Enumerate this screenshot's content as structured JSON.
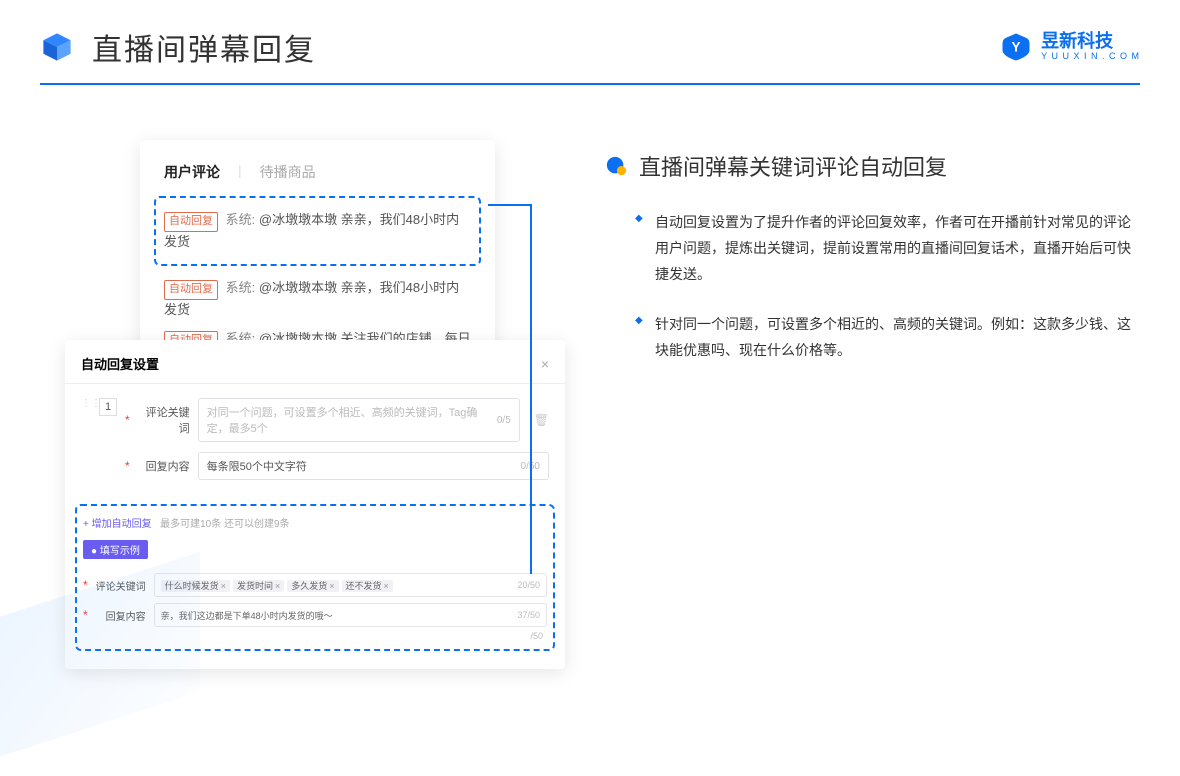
{
  "header": {
    "title": "直播间弹幕回复",
    "brand_cn": "昱新科技",
    "brand_en": "Y U U X I N . C O M"
  },
  "card1": {
    "tab_active": "用户评论",
    "tab_inactive": "待播商品",
    "auto_label": "自动回复",
    "sys_prefix": "系统:",
    "row1": "@冰墩墩本墩 亲亲，我们48小时内发货",
    "row2": "@冰墩墩本墩 亲亲，我们48小时内发货",
    "row3": "@冰墩墩本墩 关注我们的店铺，每日都有热门推荐哟～"
  },
  "card2": {
    "title": "自动回复设置",
    "priority": "1",
    "label_keyword": "评论关键词",
    "placeholder_keyword": "对同一个问题，可设置多个相近、高频的关键词，Tag确定，最多5个",
    "count_keyword": "0/5",
    "label_content": "回复内容",
    "placeholder_content": "每条限50个中文字符",
    "count_content": "0/50",
    "add_text": "+ 增加自动回复",
    "add_hint": "最多可建10条 还可以创建9条",
    "example_badge": "● 填写示例",
    "ex_kw_label": "评论关键词",
    "ex_kw_count": "20/50",
    "tags": [
      "什么时候发货",
      "发货时间",
      "多久发货",
      "还不发货"
    ],
    "ex_ct_label": "回复内容",
    "ex_ct_value": "亲，我们这边都是下单48小时内发货的哦～",
    "ex_ct_count": "37/50",
    "stray_count": "/50"
  },
  "right": {
    "section_title": "直播间弹幕关键词评论自动回复",
    "bullets": [
      "自动回复设置为了提升作者的评论回复效率，作者可在开播前针对常见的评论用户问题，提炼出关键词，提前设置常用的直播间回复话术，直播开始后可快捷发送。",
      "针对同一个问题，可设置多个相近的、高频的关键词。例如：这款多少钱、这块能优惠吗、现在什么价格等。"
    ]
  }
}
